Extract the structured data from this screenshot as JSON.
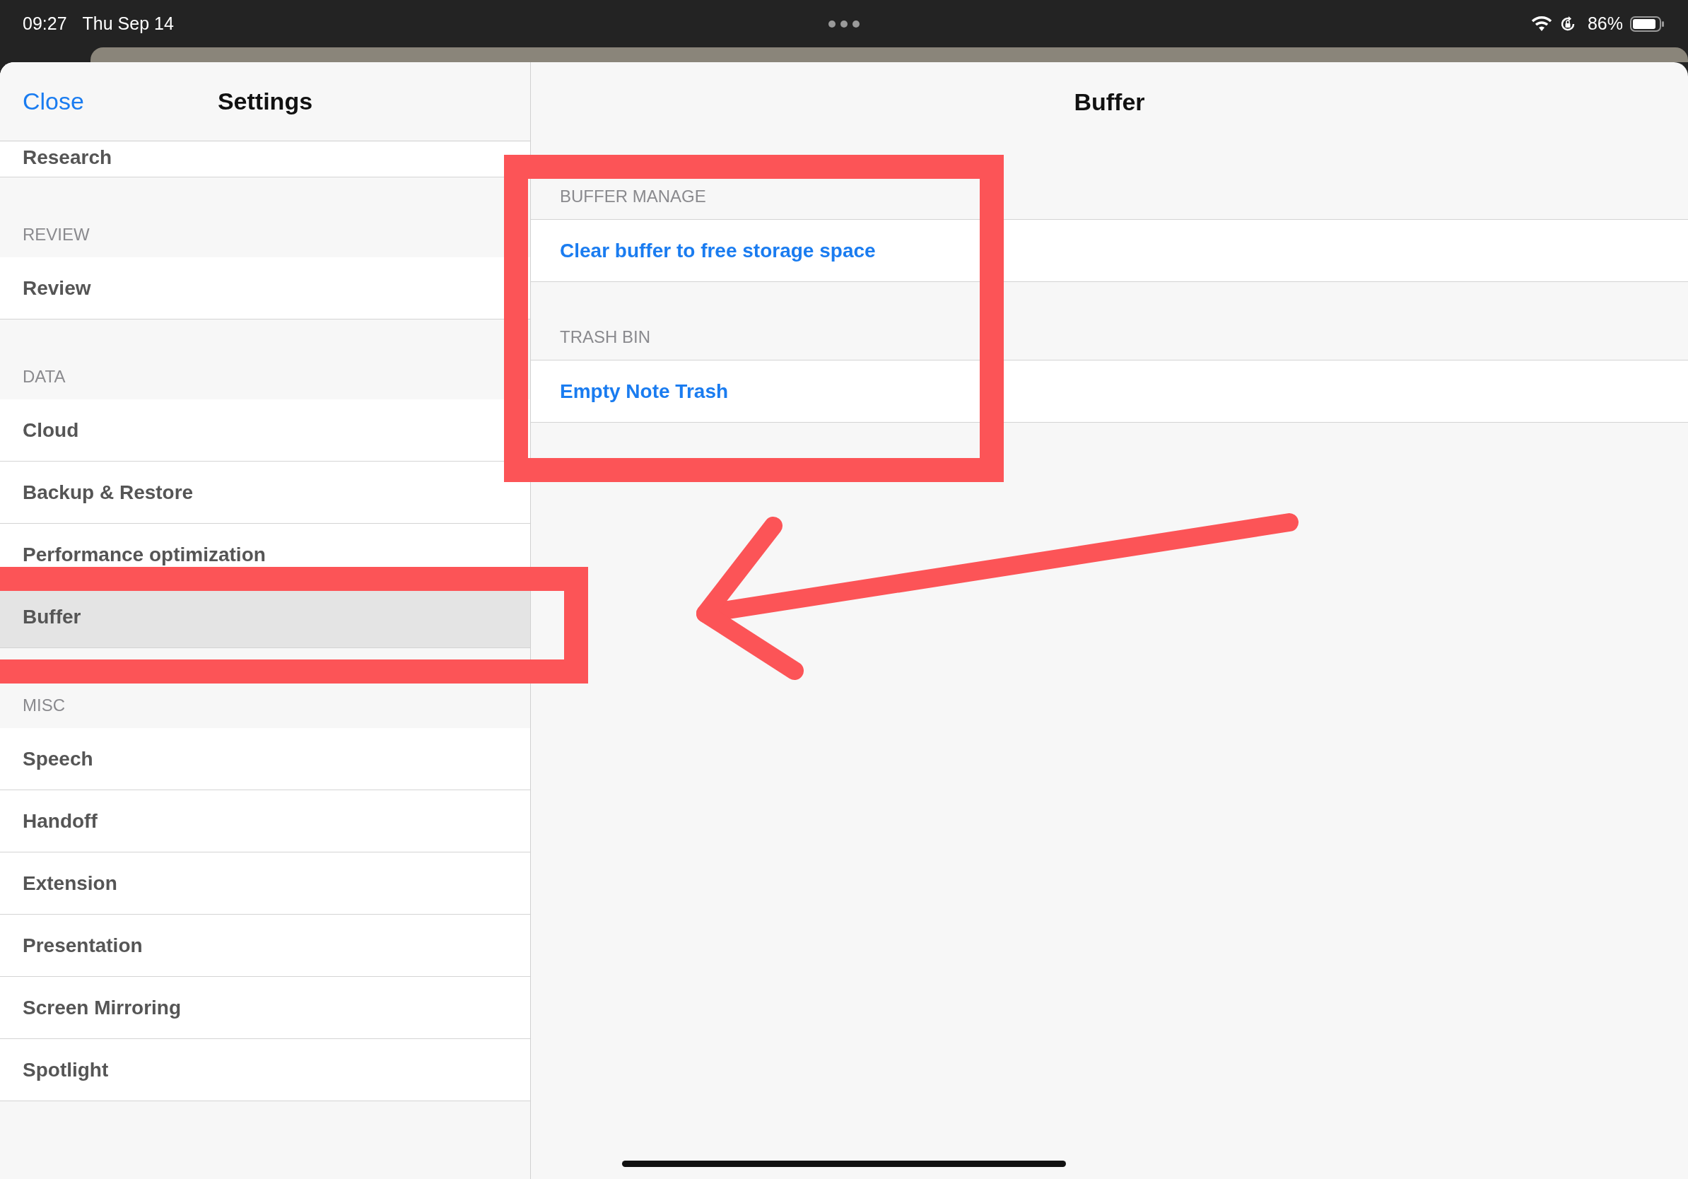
{
  "status_bar": {
    "time": "09:27",
    "date": "Thu Sep 14",
    "battery": "86%"
  },
  "sidebar": {
    "close": "Close",
    "title": "Settings",
    "sections": [
      {
        "items": [
          {
            "label": "Research",
            "selected": false
          }
        ]
      },
      {
        "header": "REVIEW",
        "items": [
          {
            "label": "Review",
            "selected": false
          }
        ]
      },
      {
        "header": "DATA",
        "items": [
          {
            "label": "Cloud",
            "selected": false
          },
          {
            "label": "Backup & Restore",
            "selected": false
          },
          {
            "label": "Performance optimization",
            "selected": false
          },
          {
            "label": "Buffer",
            "selected": true
          }
        ]
      },
      {
        "header": "MISC",
        "items": [
          {
            "label": "Speech",
            "selected": false
          },
          {
            "label": "Handoff",
            "selected": false
          },
          {
            "label": "Extension",
            "selected": false
          },
          {
            "label": "Presentation",
            "selected": false
          },
          {
            "label": "Screen Mirroring",
            "selected": false
          },
          {
            "label": "Spotlight",
            "selected": false
          }
        ]
      }
    ]
  },
  "detail": {
    "title": "Buffer",
    "sections": [
      {
        "header": "BUFFER MANAGE",
        "actions": [
          "Clear buffer to free storage space"
        ]
      },
      {
        "header": "TRASH BIN",
        "actions": [
          "Empty Note Trash"
        ]
      }
    ]
  },
  "annotations": [
    {
      "kind": "box"
    },
    {
      "kind": "box"
    },
    {
      "kind": "arrow"
    }
  ]
}
